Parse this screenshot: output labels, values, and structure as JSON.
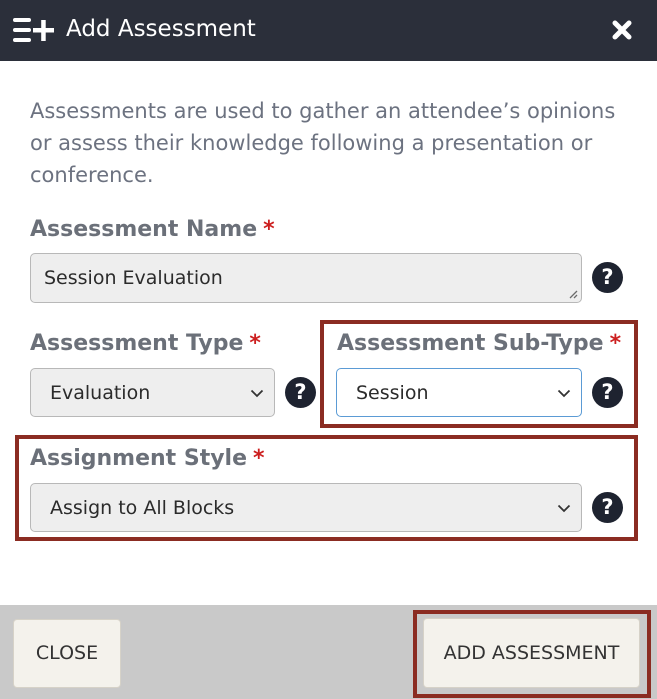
{
  "header": {
    "title": "Add Assessment",
    "title_icon": "list-plus-icon",
    "close_icon": "close-x-icon"
  },
  "intro_text": "Assessments are used to gather an attendee’s opinions or assess their knowledge following a presentation or conference.",
  "form": {
    "required_marker": "*",
    "help_glyph": "?",
    "assessment_name": {
      "label": "Assessment Name",
      "value": "Session Evaluation"
    },
    "assessment_type": {
      "label": "Assessment Type",
      "value": "Evaluation"
    },
    "assessment_sub_type": {
      "label": "Assessment Sub-Type",
      "value": "Session"
    },
    "assignment_style": {
      "label": "Assignment Style",
      "value": "Assign to All Blocks"
    }
  },
  "footer": {
    "close_label": "CLOSE",
    "add_label": "ADD ASSESSMENT"
  },
  "colors": {
    "header_bg": "#2b2f3a",
    "required": "#cc1f1f",
    "highlight_border": "#8b2c22",
    "footer_bg": "#c9c9c9"
  }
}
